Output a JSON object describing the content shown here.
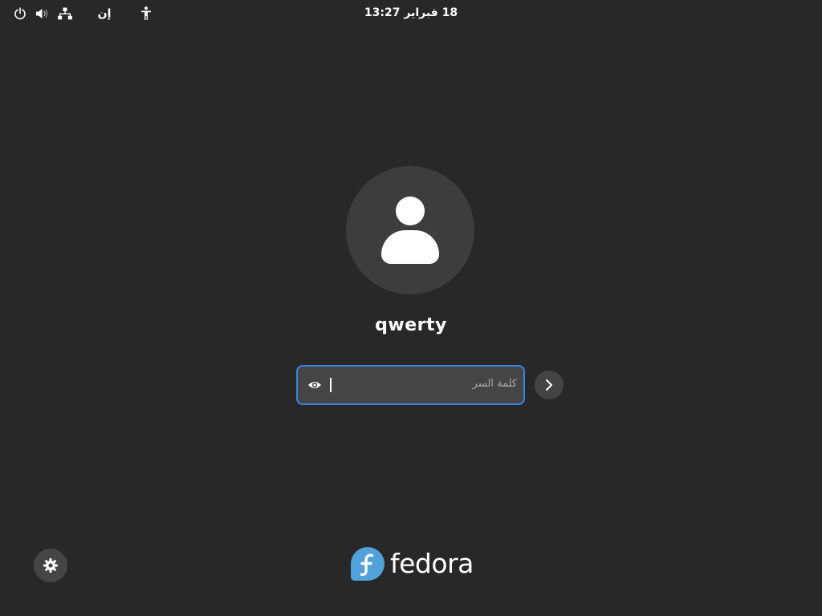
{
  "topbar": {
    "keyboard_layout": "إن",
    "clock": "18 فبراير 13:27",
    "icons": {
      "power": "power-icon",
      "volume": "volume-icon",
      "network": "network-icon",
      "accessibility": "accessibility-icon"
    }
  },
  "login": {
    "username": "qwerty",
    "password": {
      "placeholder": "كلمة السر",
      "value": ""
    },
    "reveal_icon": "eye-icon",
    "submit_icon": "chevron-right-icon"
  },
  "bottom": {
    "session_icon": "gear-icon",
    "logo_text": "fedora"
  },
  "colors": {
    "background": "#282828",
    "accent": "#3584e4",
    "fedora_blue": "#51a2da"
  }
}
